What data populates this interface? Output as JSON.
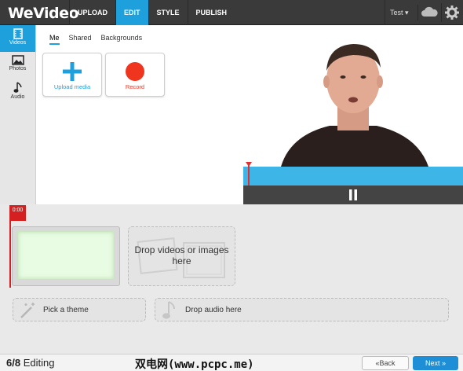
{
  "app": {
    "logo": "WeVideo"
  },
  "nav": {
    "tabs": [
      "UPLOAD",
      "EDIT",
      "STYLE",
      "PUBLISH"
    ],
    "active": "EDIT"
  },
  "user": {
    "name": "Test ▾"
  },
  "rail": {
    "items": [
      "Videos",
      "Photos",
      "Audio"
    ]
  },
  "media": {
    "subtabs": [
      "Me",
      "Shared",
      "Backgrounds"
    ],
    "upload_label": "Upload media",
    "record_label": "Record"
  },
  "timeline": {
    "time": "0:00",
    "drop_videos": "Drop videos or images here",
    "pick_theme": "Pick a theme",
    "drop_audio": "Drop audio here"
  },
  "footer": {
    "step": "6/8",
    "step_label": "Editing",
    "watermark": "双电网(www.pcpc.me)",
    "back": "«Back",
    "next": "Next »"
  },
  "colors": {
    "accent": "#1da0dc",
    "record": "#e53a2a",
    "next": "#1e8fd6"
  }
}
